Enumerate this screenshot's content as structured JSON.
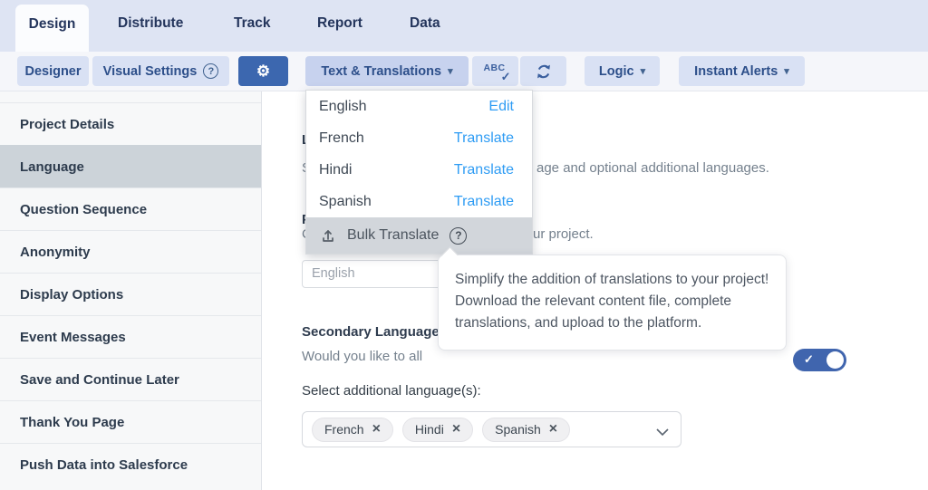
{
  "tabs": {
    "items": [
      {
        "label": "Design",
        "active": true
      },
      {
        "label": "Distribute",
        "active": false
      },
      {
        "label": "Track",
        "active": false
      },
      {
        "label": "Report",
        "active": false
      },
      {
        "label": "Data",
        "active": false
      }
    ]
  },
  "toolbar": {
    "designer_label": "Designer",
    "visual_settings_label": "Visual Settings",
    "text_translations_label": "Text & Translations",
    "abc_label": "ABC",
    "logic_label": "Logic",
    "instant_alerts_label": "Instant Alerts"
  },
  "translations_menu": {
    "rows": [
      {
        "language": "English",
        "action": "Edit"
      },
      {
        "language": "French",
        "action": "Translate"
      },
      {
        "language": "Hindi",
        "action": "Translate"
      },
      {
        "language": "Spanish",
        "action": "Translate"
      }
    ],
    "bulk_translate_label": "Bulk Translate"
  },
  "bulk_tooltip": {
    "text": "Simplify the addition of translations to your project! Download the relevant content file, complete translations, and upload to the platform."
  },
  "sidebar": {
    "items": [
      {
        "label": "Project Details",
        "selected": false
      },
      {
        "label": "Language",
        "selected": true
      },
      {
        "label": "Question Sequence",
        "selected": false
      },
      {
        "label": "Anonymity",
        "selected": false
      },
      {
        "label": "Display Options",
        "selected": false
      },
      {
        "label": "Event Messages",
        "selected": false
      },
      {
        "label": "Save and Continue Later",
        "selected": false
      },
      {
        "label": "Thank You Page",
        "selected": false
      },
      {
        "label": "Push Data into Salesforce",
        "selected": false
      }
    ]
  },
  "content": {
    "language_heading": "Language",
    "language_subtitle_visible_start": "S",
    "language_subtitle_visible_end": "age and optional additional languages.",
    "primary_heading": "Primary Language",
    "primary_subtitle_visible_start": "C",
    "primary_subtitle_visible_end": "ur project.",
    "primary_language_value": "English",
    "secondary_heading_visible": "Secondary Languages",
    "secondary_subtitle_visible": "Would you like to all",
    "secondary_toggle_on": true,
    "additional_languages_label": "Select additional language(s):",
    "selected_languages": [
      {
        "label": "French"
      },
      {
        "label": "Hindi"
      },
      {
        "label": "Spanish"
      }
    ]
  },
  "icons": {
    "gear": "⚙",
    "check": "✓",
    "close": "×",
    "caret_down": "▾",
    "question": "?"
  },
  "colors": {
    "tabbar_bg": "#dee4f3",
    "button_bg": "#d9e1f4",
    "button_text": "#2d4f8a",
    "accent_blue": "#3c67af",
    "toggle_blue": "#4065ae",
    "link_blue": "#2e9cf4",
    "sidebar_selected_bg": "#ccd3d9",
    "bulk_row_bg": "#d2d6db"
  }
}
